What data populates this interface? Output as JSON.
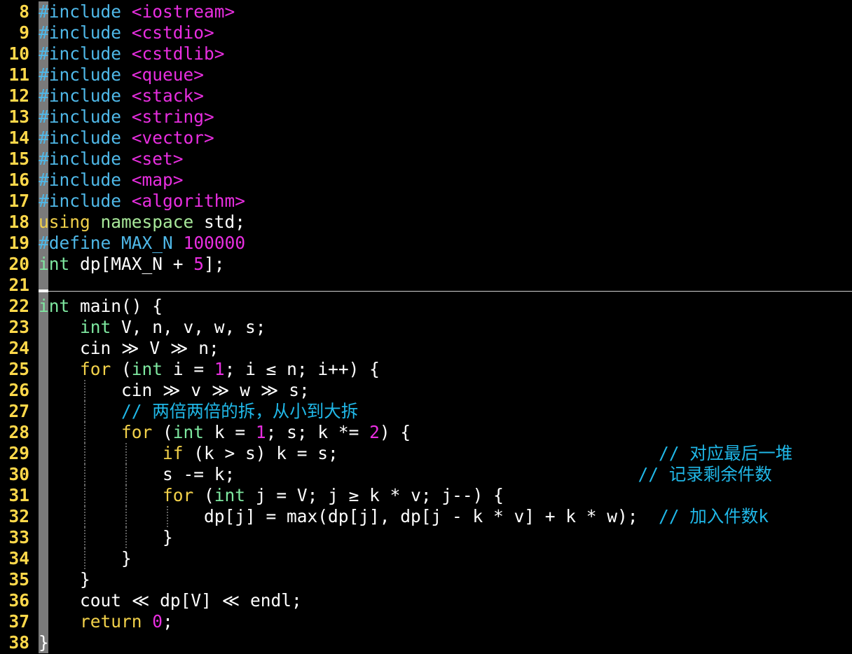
{
  "editor": {
    "colors": {
      "background": "#000000",
      "line_number": "#ffd84a",
      "preprocessor": "#4fb8e8",
      "string": "#e82ee0",
      "keyword": "#f2d14a",
      "type": "#7ee8a0",
      "comment": "#20b8e8",
      "text": "#ffffff"
    },
    "lines": [
      {
        "num": "8",
        "tokens": [
          {
            "t": "#include",
            "c": "pp"
          },
          {
            "t": " ",
            "c": "plain"
          },
          {
            "t": "<iostream>",
            "c": "str"
          }
        ]
      },
      {
        "num": "9",
        "tokens": [
          {
            "t": "#include",
            "c": "pp"
          },
          {
            "t": " ",
            "c": "plain"
          },
          {
            "t": "<cstdio>",
            "c": "str"
          }
        ]
      },
      {
        "num": "10",
        "tokens": [
          {
            "t": "#include",
            "c": "pp"
          },
          {
            "t": " ",
            "c": "plain"
          },
          {
            "t": "<cstdlib>",
            "c": "str"
          }
        ]
      },
      {
        "num": "11",
        "tokens": [
          {
            "t": "#include",
            "c": "pp"
          },
          {
            "t": " ",
            "c": "plain"
          },
          {
            "t": "<queue>",
            "c": "str"
          }
        ]
      },
      {
        "num": "12",
        "tokens": [
          {
            "t": "#include",
            "c": "pp"
          },
          {
            "t": " ",
            "c": "plain"
          },
          {
            "t": "<stack>",
            "c": "str"
          }
        ]
      },
      {
        "num": "13",
        "tokens": [
          {
            "t": "#include",
            "c": "pp"
          },
          {
            "t": " ",
            "c": "plain"
          },
          {
            "t": "<string>",
            "c": "str"
          }
        ]
      },
      {
        "num": "14",
        "tokens": [
          {
            "t": "#include",
            "c": "pp"
          },
          {
            "t": " ",
            "c": "plain"
          },
          {
            "t": "<vector>",
            "c": "str"
          }
        ]
      },
      {
        "num": "15",
        "tokens": [
          {
            "t": "#include",
            "c": "pp"
          },
          {
            "t": " ",
            "c": "plain"
          },
          {
            "t": "<set>",
            "c": "str"
          }
        ]
      },
      {
        "num": "16",
        "tokens": [
          {
            "t": "#include",
            "c": "pp"
          },
          {
            "t": " ",
            "c": "plain"
          },
          {
            "t": "<map>",
            "c": "str"
          }
        ]
      },
      {
        "num": "17",
        "tokens": [
          {
            "t": "#include",
            "c": "pp"
          },
          {
            "t": " ",
            "c": "plain"
          },
          {
            "t": "<algorithm>",
            "c": "str"
          }
        ]
      },
      {
        "num": "18",
        "tokens": [
          {
            "t": "using",
            "c": "kw"
          },
          {
            "t": " ",
            "c": "plain"
          },
          {
            "t": "namespace",
            "c": "ns"
          },
          {
            "t": " std;",
            "c": "plain"
          }
        ]
      },
      {
        "num": "19",
        "tokens": [
          {
            "t": "#define",
            "c": "pp"
          },
          {
            "t": " ",
            "c": "plain"
          },
          {
            "t": "MAX_N",
            "c": "mac"
          },
          {
            "t": " ",
            "c": "plain"
          },
          {
            "t": "100000",
            "c": "num"
          }
        ]
      },
      {
        "num": "20",
        "tokens": [
          {
            "t": "int",
            "c": "type"
          },
          {
            "t": " dp[MAX_N + ",
            "c": "plain"
          },
          {
            "t": "5",
            "c": "num"
          },
          {
            "t": "];",
            "c": "plain"
          }
        ]
      },
      {
        "num": "21",
        "tokens": []
      },
      {
        "num": "22",
        "tokens": [
          {
            "t": "int",
            "c": "type"
          },
          {
            "t": " main() {",
            "c": "plain"
          }
        ]
      },
      {
        "num": "23",
        "tokens": [
          {
            "t": "    ",
            "c": "plain"
          },
          {
            "t": "int",
            "c": "type"
          },
          {
            "t": " V, n, v, w, s;",
            "c": "plain"
          }
        ]
      },
      {
        "num": "24",
        "tokens": [
          {
            "t": "    cin ≫ V ≫ n;",
            "c": "plain"
          }
        ]
      },
      {
        "num": "25",
        "tokens": [
          {
            "t": "    ",
            "c": "plain"
          },
          {
            "t": "for",
            "c": "kw"
          },
          {
            "t": " (",
            "c": "plain"
          },
          {
            "t": "int",
            "c": "type"
          },
          {
            "t": " i = ",
            "c": "plain"
          },
          {
            "t": "1",
            "c": "num"
          },
          {
            "t": "; i ≤ n; i++) {",
            "c": "plain"
          }
        ]
      },
      {
        "num": "26",
        "tokens": [
          {
            "t": "        cin ≫ v ≫ w ≫ s;",
            "c": "plain"
          }
        ]
      },
      {
        "num": "27",
        "tokens": [
          {
            "t": "        ",
            "c": "plain"
          },
          {
            "t": "// 两倍两倍的拆，从小到大拆",
            "c": "cmt"
          }
        ]
      },
      {
        "num": "28",
        "tokens": [
          {
            "t": "        ",
            "c": "plain"
          },
          {
            "t": "for",
            "c": "kw"
          },
          {
            "t": " (",
            "c": "plain"
          },
          {
            "t": "int",
            "c": "type"
          },
          {
            "t": " k = ",
            "c": "plain"
          },
          {
            "t": "1",
            "c": "num"
          },
          {
            "t": "; s; k *= ",
            "c": "plain"
          },
          {
            "t": "2",
            "c": "num"
          },
          {
            "t": ") {",
            "c": "plain"
          }
        ]
      },
      {
        "num": "29",
        "tokens": [
          {
            "t": "            ",
            "c": "plain"
          },
          {
            "t": "if",
            "c": "kw"
          },
          {
            "t": " (k > s) k = s;                               ",
            "c": "plain"
          },
          {
            "t": "// 对应最后一堆",
            "c": "cmt"
          }
        ]
      },
      {
        "num": "30",
        "tokens": [
          {
            "t": "            s -= k;                                       ",
            "c": "plain"
          },
          {
            "t": "// 记录剩余件数",
            "c": "cmt"
          }
        ]
      },
      {
        "num": "31",
        "tokens": [
          {
            "t": "            ",
            "c": "plain"
          },
          {
            "t": "for",
            "c": "kw"
          },
          {
            "t": " (",
            "c": "plain"
          },
          {
            "t": "int",
            "c": "type"
          },
          {
            "t": " j = V; j ≥ k * v; j--) {",
            "c": "plain"
          }
        ]
      },
      {
        "num": "32",
        "tokens": [
          {
            "t": "                dp[j] = max(dp[j], dp[j - k * v] + k * w);  ",
            "c": "plain"
          },
          {
            "t": "// 加入件数k",
            "c": "cmt"
          }
        ]
      },
      {
        "num": "33",
        "tokens": [
          {
            "t": "            }",
            "c": "plain"
          }
        ]
      },
      {
        "num": "34",
        "tokens": [
          {
            "t": "        }",
            "c": "plain"
          }
        ]
      },
      {
        "num": "35",
        "tokens": [
          {
            "t": "    }",
            "c": "plain"
          }
        ]
      },
      {
        "num": "36",
        "tokens": [
          {
            "t": "    cout ≪ dp[V] ≪ endl;",
            "c": "plain"
          }
        ]
      },
      {
        "num": "37",
        "tokens": [
          {
            "t": "    ",
            "c": "plain"
          },
          {
            "t": "return",
            "c": "kw"
          },
          {
            "t": " ",
            "c": "plain"
          },
          {
            "t": "0",
            "c": "num"
          },
          {
            "t": ";",
            "c": "plain"
          }
        ]
      },
      {
        "num": "38",
        "tokens": [
          {
            "t": "}",
            "c": "plain"
          }
        ]
      }
    ]
  }
}
